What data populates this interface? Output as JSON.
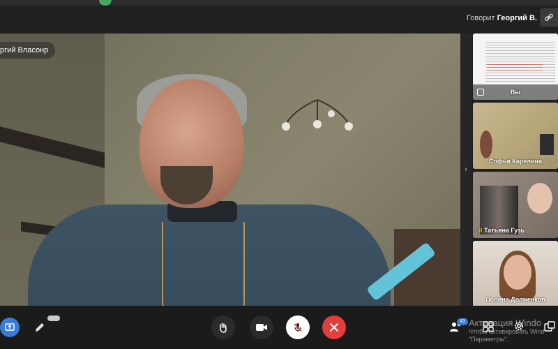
{
  "header": {
    "speaking_prefix": "Говорит",
    "speaking_name": "Георгий В."
  },
  "main_video": {
    "name_tag": "ргий Власонр"
  },
  "participants": [
    {
      "label": "Вы",
      "type": "screen-share"
    },
    {
      "label": "Софья Карелина"
    },
    {
      "label": "Татьяна Гузь"
    },
    {
      "label": "Полина Долженков"
    }
  ],
  "toolbar": {
    "participants_count": "43"
  },
  "watermark": {
    "title": "Активация Windo",
    "line1": "Чтобы активировать Wind",
    "line2": "\"Параметры\"."
  },
  "colors": {
    "accent": "#3a7bd5",
    "hangup": "#e33d3d"
  },
  "icons": [
    "link-icon",
    "screen-share-icon",
    "pen-icon",
    "raise-hand-icon",
    "camera-icon",
    "mic-muted-icon",
    "close-icon",
    "participants-icon",
    "grid-view-icon",
    "gear-icon",
    "layout-icon",
    "chevron-right-icon"
  ]
}
